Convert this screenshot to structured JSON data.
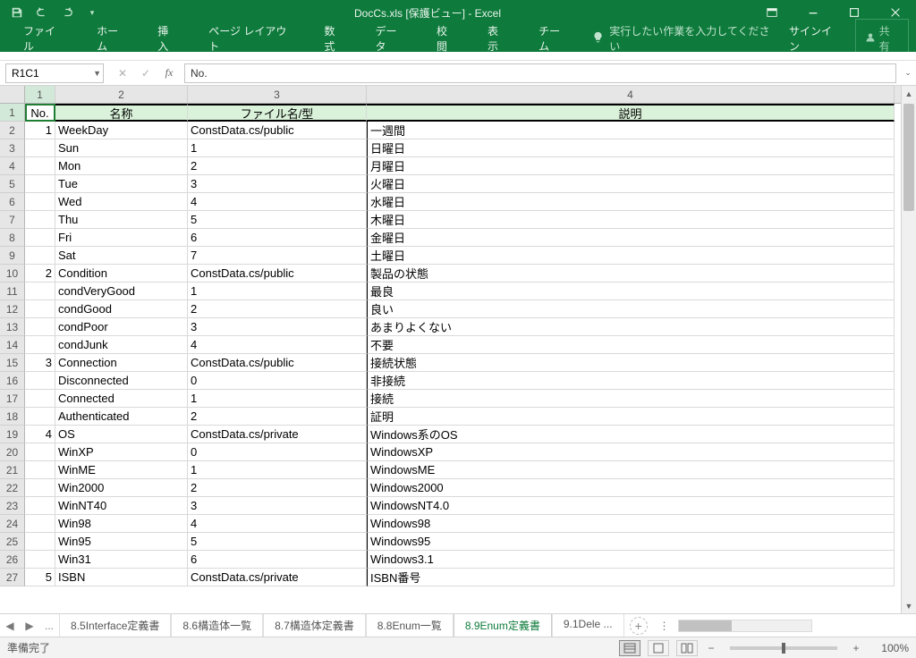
{
  "titlebar": {
    "title": "DocCs.xls  [保護ビュー] - Excel"
  },
  "ribbon": {
    "tabs": [
      "ファイル",
      "ホーム",
      "挿入",
      "ページ レイアウト",
      "数式",
      "データ",
      "校閲",
      "表示",
      "チーム"
    ],
    "tellme_placeholder": "実行したい作業を入力してください",
    "signin": "サインイン",
    "share": "共有"
  },
  "namebox": "R1C1",
  "formula": "No.",
  "columns": {
    "c1": "1",
    "c2": "2",
    "c3": "3",
    "c4": "4"
  },
  "header_row": [
    "No.",
    "名称",
    "ファイル名/型",
    "説明"
  ],
  "rows": [
    {
      "r": "2",
      "no": "1",
      "name": "WeekDay",
      "file": "ConstData.cs/public",
      "desc": "一週間"
    },
    {
      "r": "3",
      "no": "",
      "name": "Sun",
      "file": "1",
      "desc": "日曜日"
    },
    {
      "r": "4",
      "no": "",
      "name": "Mon",
      "file": "2",
      "desc": "月曜日"
    },
    {
      "r": "5",
      "no": "",
      "name": "Tue",
      "file": "3",
      "desc": "火曜日"
    },
    {
      "r": "6",
      "no": "",
      "name": "Wed",
      "file": "4",
      "desc": "水曜日"
    },
    {
      "r": "7",
      "no": "",
      "name": "Thu",
      "file": "5",
      "desc": "木曜日"
    },
    {
      "r": "8",
      "no": "",
      "name": "Fri",
      "file": "6",
      "desc": "金曜日"
    },
    {
      "r": "9",
      "no": "",
      "name": "Sat",
      "file": "7",
      "desc": "土曜日"
    },
    {
      "r": "10",
      "no": "2",
      "name": "Condition",
      "file": "ConstData.cs/public",
      "desc": "製品の状態"
    },
    {
      "r": "11",
      "no": "",
      "name": "condVeryGood",
      "file": "1",
      "desc": "最良"
    },
    {
      "r": "12",
      "no": "",
      "name": "condGood",
      "file": "2",
      "desc": "良い"
    },
    {
      "r": "13",
      "no": "",
      "name": "condPoor",
      "file": "3",
      "desc": "あまりよくない"
    },
    {
      "r": "14",
      "no": "",
      "name": "condJunk",
      "file": "4",
      "desc": "不要"
    },
    {
      "r": "15",
      "no": "3",
      "name": "Connection",
      "file": "ConstData.cs/public",
      "desc": "接続状態"
    },
    {
      "r": "16",
      "no": "",
      "name": "Disconnected",
      "file": "0",
      "desc": "非接続"
    },
    {
      "r": "17",
      "no": "",
      "name": "Connected",
      "file": "1",
      "desc": "接続"
    },
    {
      "r": "18",
      "no": "",
      "name": "Authenticated",
      "file": "2",
      "desc": "証明"
    },
    {
      "r": "19",
      "no": "4",
      "name": "OS",
      "file": "ConstData.cs/private",
      "desc": "Windows系のOS"
    },
    {
      "r": "20",
      "no": "",
      "name": "WinXP",
      "file": "0",
      "desc": "WindowsXP"
    },
    {
      "r": "21",
      "no": "",
      "name": "WinME",
      "file": "1",
      "desc": "WindowsME"
    },
    {
      "r": "22",
      "no": "",
      "name": "Win2000",
      "file": "2",
      "desc": "Windows2000"
    },
    {
      "r": "23",
      "no": "",
      "name": "WinNT40",
      "file": "3",
      "desc": "WindowsNT4.0"
    },
    {
      "r": "24",
      "no": "",
      "name": "Win98",
      "file": "4",
      "desc": "Windows98"
    },
    {
      "r": "25",
      "no": "",
      "name": "Win95",
      "file": "5",
      "desc": "Windows95"
    },
    {
      "r": "26",
      "no": "",
      "name": "Win31",
      "file": "6",
      "desc": "Windows3.1"
    },
    {
      "r": "27",
      "no": "5",
      "name": "ISBN",
      "file": "ConstData.cs/private",
      "desc": "ISBN番号"
    }
  ],
  "sheet_tabs": {
    "left_ellipsis": "...",
    "tabs": [
      "8.5Interface定義書",
      "8.6構造体一覧",
      "8.7構造体定義書",
      "8.8Enum一覧",
      "8.9Enum定義書",
      "9.1Dele ..."
    ],
    "active_index": 4
  },
  "status": {
    "ready": "準備完了",
    "zoom": "100%"
  }
}
